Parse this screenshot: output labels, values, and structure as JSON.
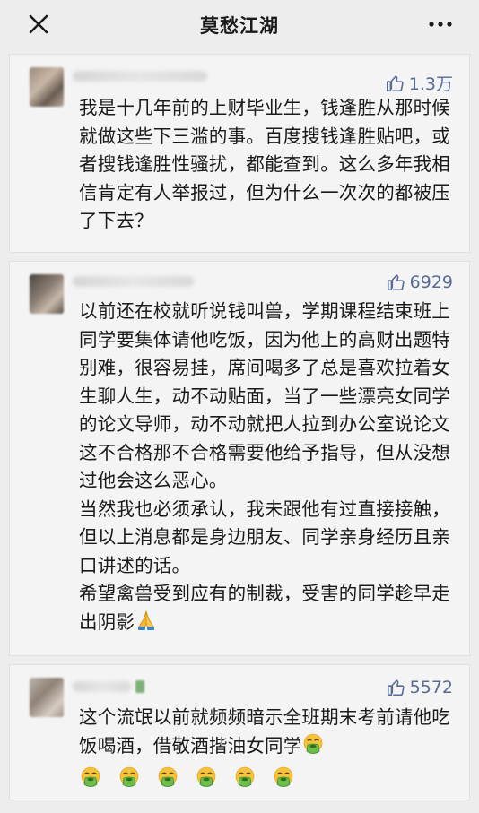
{
  "header": {
    "title": "莫愁江湖",
    "close_icon": "close-icon",
    "more_icon": "more-dots-icon"
  },
  "colors": {
    "background": "#ededed",
    "card": "#f4f4f4",
    "like_blue": "#576b95"
  },
  "comments": [
    {
      "likes": "1.3万",
      "paragraphs": [
        "我是十几年前的上财毕业生，钱逢胜从那时候就做这些下三滥的事。百度搜钱逢胜贴吧，或者搜钱逢胜性骚扰，都能查到。这么多年我相信肯定有人举报过，但为什么一次次的都被压了下去？"
      ]
    },
    {
      "likes": "6929",
      "paragraphs": [
        "以前还在校就听说钱叫兽，学期课程结束班上同学要集体请他吃饭，因为他上的高财出题特别难，很容易挂，席间喝多了总是喜欢拉着女生聊人生，动不动贴面，当了一些漂亮女同学的论文导师，动不动就把人拉到办公室说论文这不合格那不合格需要他给予指导，但从没想过他会这么恶心。",
        "当然我也必须承认，我未跟他有过直接接触，但以上消息都是身边朋友、同学亲身经历且亲口讲述的话。",
        "希望禽兽受到应有的制裁，受害的同学趁早走出阴影"
      ],
      "trailing_emoji": "folded-hands-emoji"
    },
    {
      "likes": "5572",
      "paragraphs": [
        "这个流氓以前就频频暗示全班期末考前请他吃饭喝酒，借敬酒揩油女同学"
      ],
      "trailing_emoji": "nauseated-face-emoji",
      "emoji_row_count": 6
    }
  ]
}
